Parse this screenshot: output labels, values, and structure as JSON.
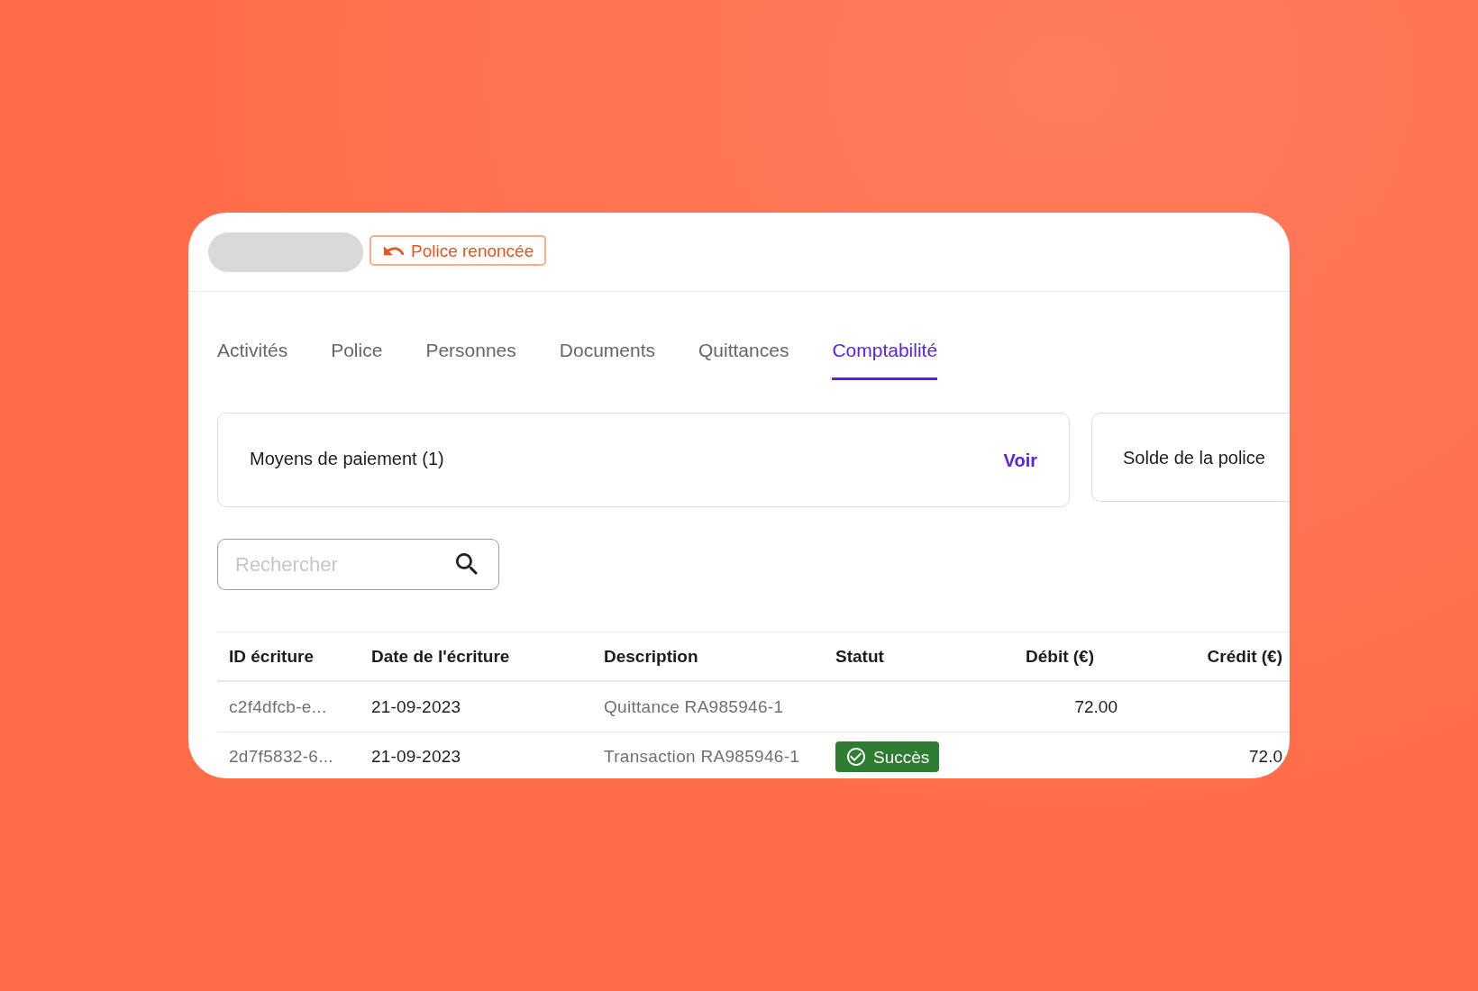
{
  "header": {
    "tag": {
      "label": "Police renoncée"
    }
  },
  "tabs": [
    {
      "label": "Activités",
      "selected": false
    },
    {
      "label": "Police",
      "selected": false
    },
    {
      "label": "Personnes",
      "selected": false
    },
    {
      "label": "Documents",
      "selected": false
    },
    {
      "label": "Quittances",
      "selected": false
    },
    {
      "label": "Comptabilité",
      "selected": true
    }
  ],
  "summary_cards": [
    {
      "title": "Moyens de paiement (1)",
      "link": "Voir"
    },
    {
      "title": "Solde de la police"
    }
  ],
  "search": {
    "placeholder": "Rechercher"
  },
  "table": {
    "columns": [
      "ID écriture",
      "Date de l'écriture",
      "Description",
      "Statut",
      "Débit (€)",
      "Crédit (€)"
    ],
    "rows": [
      {
        "id": "c2f4dfcb-e...",
        "date": "21-09-2023",
        "description": "Quittance RA985946-1",
        "debit": "72.00"
      },
      {
        "id": "2d7f5832-6...",
        "date": "21-09-2023",
        "description": "Transaction RA985946-1",
        "status": {
          "label": "Succès",
          "kind": "success"
        },
        "credit": "72.0"
      }
    ]
  }
}
